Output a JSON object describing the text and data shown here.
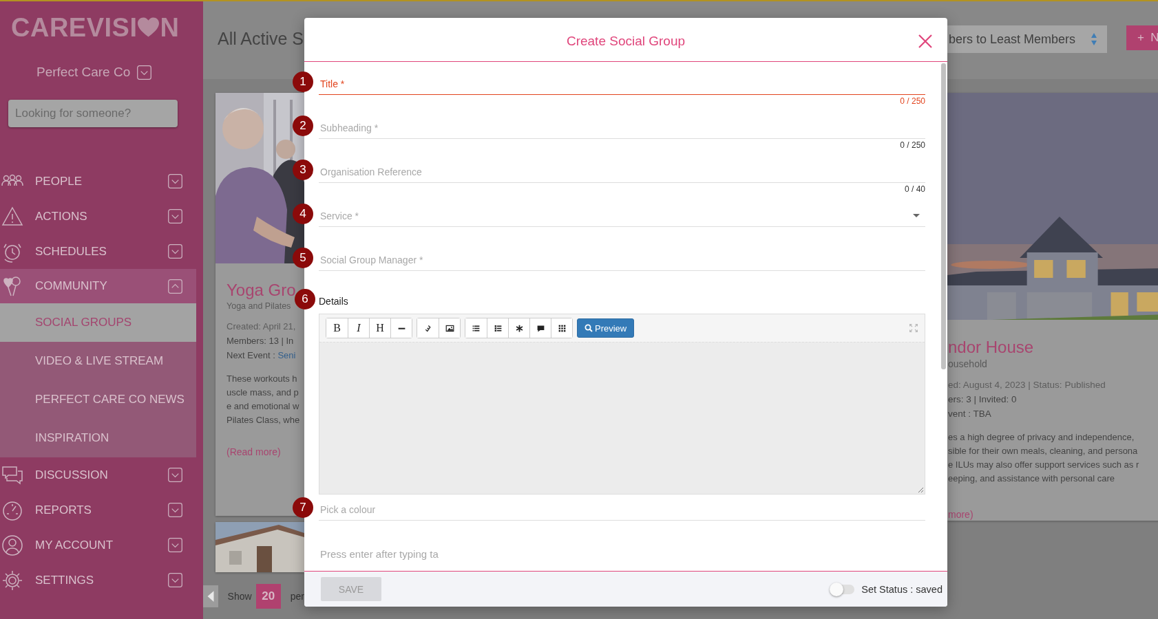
{
  "sidebar": {
    "logo": {
      "before": "CAREVISI",
      "after": "N"
    },
    "organisation": "Perfect Care Co",
    "search": {
      "placeholder": "Looking for someone?"
    },
    "nav": [
      {
        "label": "PEOPLE",
        "expanded": false
      },
      {
        "label": "ACTIONS",
        "expanded": false
      },
      {
        "label": "SCHEDULES",
        "expanded": false
      },
      {
        "label": "COMMUNITY",
        "expanded": true,
        "children": [
          {
            "label": "SOCIAL GROUPS",
            "selected": true
          },
          {
            "label": "VIDEO & LIVE STREAM",
            "selected": false
          },
          {
            "label": "PERFECT CARE CO NEWS",
            "selected": false
          },
          {
            "label": "INSPIRATION",
            "selected": false
          }
        ]
      },
      {
        "label": "DISCUSSION",
        "expanded": false
      },
      {
        "label": "REPORTS",
        "expanded": false
      },
      {
        "label": "MY ACCOUNT",
        "expanded": false
      },
      {
        "label": "SETTINGS",
        "expanded": false
      }
    ]
  },
  "header": {
    "title": "All Active S",
    "sort": "bers to Least Members",
    "new_button": "+  N"
  },
  "left_card": {
    "title": "Yoga Gro",
    "subtitle": "Yoga and Pilates",
    "created": "Created: April 21,",
    "members": "Members: 13 | In",
    "next_event_label": "Next Event : ",
    "next_event_link": "Seni",
    "description": [
      "These workouts h",
      "uscle mass, and p",
      "e and emotional w",
      "Pilates Class, whe"
    ],
    "read_more": "(Read more)"
  },
  "right_card": {
    "title": "ndor House",
    "subtitle": "ousehold",
    "created": "ed: August 4, 2023 | Status: Published",
    "members": "ers: 3 | Invited: 0",
    "next_event_label": "vent : TBA",
    "description": [
      "es a high degree of privacy and independence,",
      "sible for their own meals, cleaning, and persona",
      "e ILUs may also offer support services such as r",
      "eeping, and assistance with personal care"
    ],
    "read_more": "more)"
  },
  "pagination": {
    "show": "Show",
    "page_size": "20",
    "per": "per"
  },
  "modal": {
    "title": "Create Social Group",
    "fields": [
      {
        "kind": "text",
        "marker": "1",
        "placeholder": "Title *",
        "counter": "0 / 250",
        "error": true
      },
      {
        "kind": "text",
        "marker": "2",
        "placeholder": "Subheading *",
        "counter": "0 / 250",
        "error": false
      },
      {
        "kind": "text",
        "marker": "3",
        "placeholder": "Organisation Reference",
        "counter": "0 / 40",
        "error": false
      },
      {
        "kind": "select",
        "marker": "4",
        "placeholder": "Service *"
      },
      {
        "kind": "text",
        "marker": "5",
        "placeholder": "Social Group Manager *",
        "error": false
      },
      {
        "kind": "editor",
        "marker": "6",
        "label": "Details",
        "preview": "Preview",
        "toolbar": [
          [
            {
              "kind": "glyph",
              "glyph": "B"
            },
            {
              "kind": "glyph",
              "glyph": "I"
            },
            {
              "kind": "glyph",
              "glyph": "H"
            },
            {
              "kind": "icon"
            }
          ],
          [
            {
              "kind": "icon"
            },
            {
              "kind": "icon"
            }
          ],
          [
            {
              "kind": "icon"
            },
            {
              "kind": "icon"
            },
            {
              "kind": "icon"
            },
            {
              "kind": "icon"
            },
            {
              "kind": "icon"
            }
          ]
        ]
      },
      {
        "kind": "text",
        "marker": "7",
        "placeholder": "Pick a colour",
        "error": false
      },
      {
        "kind": "tags",
        "placeholder": "Press enter after typing ta"
      }
    ],
    "footer": {
      "save": {
        "label": "SAVE",
        "disabled": true
      },
      "status": {
        "on": false,
        "label": "Set Status : saved"
      }
    }
  }
}
